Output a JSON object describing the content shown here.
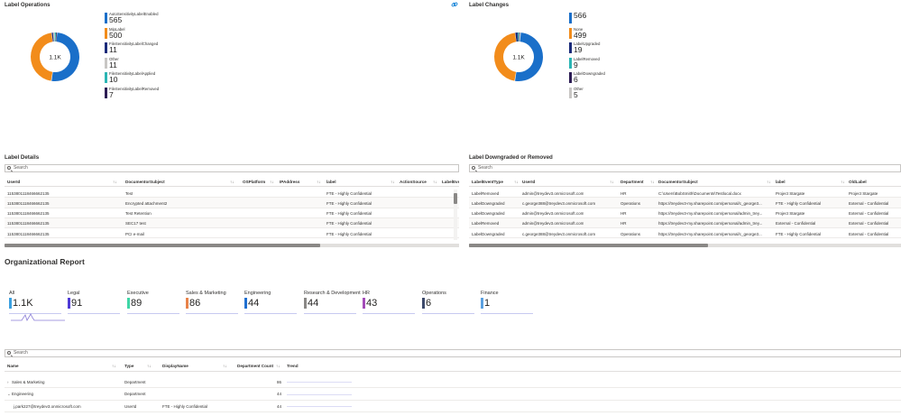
{
  "label_operations": {
    "title": "Label Operations",
    "center": "1.1K",
    "items": [
      {
        "name": "AutoSensitivityLabelEnabled",
        "value": "565",
        "color": "#1a6fc9"
      },
      {
        "name": "MipLabel",
        "value": "500",
        "color": "#f28c1b"
      },
      {
        "name": "FileSensitivityLabelChanged",
        "value": "11",
        "color": "#1a2b7a"
      },
      {
        "name": "Other",
        "value": "11",
        "color": "#c8c6c4"
      },
      {
        "name": "FileSensitivityLabelApplied",
        "value": "10",
        "color": "#2bb5b4"
      },
      {
        "name": "FileSensitivityLabelRemoved",
        "value": "7",
        "color": "#2d1d55"
      }
    ]
  },
  "label_changes": {
    "title": "Label Changes",
    "center": "1.1K",
    "items": [
      {
        "name": "",
        "value": "566",
        "color": "#1a6fc9"
      },
      {
        "name": "None",
        "value": "499",
        "color": "#f28c1b"
      },
      {
        "name": "LabelUpgraded",
        "value": "19",
        "color": "#1a2b7a"
      },
      {
        "name": "LabelRemoved",
        "value": "9",
        "color": "#2bb5b4"
      },
      {
        "name": "LabelDowngraded",
        "value": "6",
        "color": "#2d1d55"
      },
      {
        "name": "Other",
        "value": "5",
        "color": "#c8c6c4"
      }
    ]
  },
  "label_details": {
    "title": "Label Details",
    "search_placeholder": "Search",
    "columns": [
      "UserId",
      "DocumentorSubject",
      "OSPlatform",
      "IPAddress",
      "label",
      "ActionSource",
      "LabelEve"
    ],
    "rows": [
      [
        "11538011184666621​35",
        "Test",
        "",
        "",
        "FTE - Highly Confidential",
        "",
        ""
      ],
      [
        "1153801118466662135",
        "Encrypted attachment2",
        "",
        "",
        "FTE - Highly Confidential",
        "",
        ""
      ],
      [
        "1153801118466662135",
        "Test Retention",
        "",
        "",
        "FTE - Highly Confidential",
        "",
        ""
      ],
      [
        "1153801118466662135",
        "SEC17 test",
        "",
        "",
        "FTE - Highly Confidential",
        "",
        ""
      ],
      [
        "1153801118466662135",
        "PCI e-mail",
        "",
        "",
        "FTE - Highly Confidential",
        "",
        ""
      ]
    ]
  },
  "label_downgraded": {
    "title": "Label Downgraded or Removed",
    "search_placeholder": "Search",
    "columns": [
      "LabelEventType",
      "UserId",
      "Department",
      "DocumentorSubject",
      "label",
      "OldLabel"
    ],
    "rows": [
      [
        "LabelRemoved",
        "admin@treydev3.onmicrosoft.com",
        "HR",
        "C:\\Users\\BobSmith\\Documents\\Testlocal.docx",
        "Project Stargate",
        "Project Stargate"
      ],
      [
        "LabelDowngraded",
        "c.george388@treydev3.onmicrosoft.com",
        "Operations",
        "https://treydev3-my.sharepoint.com/personal/c_george3...",
        "FTE - Highly Confidential",
        "External - Confidential"
      ],
      [
        "LabelDowngraded",
        "admin@treydev3.onmicrosoft.com",
        "HR",
        "https://treydev3-my.sharepoint.com/personal/admin_trey...",
        "Project Stargate",
        "External - Confidential"
      ],
      [
        "LabelRemoved",
        "admin@treydev3.onmicrosoft.com",
        "HR",
        "https://treydev3-my.sharepoint.com/personal/admin_trey...",
        "External - Confidential",
        "External - Confidential"
      ],
      [
        "LabelDowngraded",
        "c.george388@treydev3.onmicrosoft.com",
        "Operations",
        "https://treydev3-my.sharepoint.com/personal/c_george3...",
        "FTE - Highly Confidential",
        "External - Confidential"
      ]
    ]
  },
  "org_report": {
    "title": "Organizational Report",
    "tiles": [
      {
        "name": "All",
        "value": "1.1K",
        "color": "#3aa0e0"
      },
      {
        "name": "Legal",
        "value": "91",
        "color": "#4f3bd6"
      },
      {
        "name": "Executive",
        "value": "89",
        "color": "#3fd6a6"
      },
      {
        "name": "Sales & Marketing",
        "value": "86",
        "color": "#e8834a"
      },
      {
        "name": "Engineering",
        "value": "44",
        "color": "#1f6fd0"
      },
      {
        "name": "Research & Development",
        "value": "44",
        "color": "#8a8886"
      },
      {
        "name": "HR",
        "value": "43",
        "color": "#a34bb8"
      },
      {
        "name": "Operations",
        "value": "6",
        "color": "#3d4a6b"
      },
      {
        "name": "Finance",
        "value": "1",
        "color": "#5aa0e0"
      }
    ],
    "search_placeholder": "Search",
    "columns": [
      "Name",
      "Type",
      "DisplayName",
      "Department Count",
      "Trend"
    ],
    "rows": [
      {
        "name": "Sales & Marketing",
        "type": "Department",
        "display": "",
        "count": "86",
        "expander": "›"
      },
      {
        "name": "Engineering",
        "type": "Department",
        "display": "",
        "count": "44",
        "expander": "⌄"
      },
      {
        "name": "j.park227@treydev3.onmicrosoft.com",
        "type": "UserId",
        "display": "FTE - Highly Confidential",
        "count": "44",
        "expander": ""
      }
    ]
  },
  "sort_glyph": "↑↓"
}
